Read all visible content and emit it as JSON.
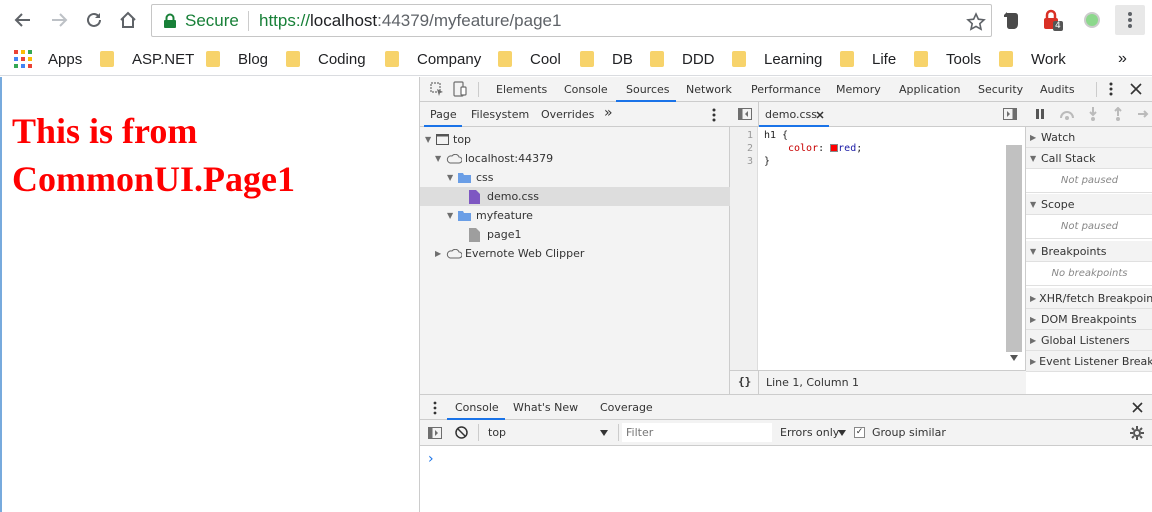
{
  "browser": {
    "secure_label": "Secure",
    "url_scheme": "https://",
    "url_host": "localhost",
    "url_rest": ":44379/myfeature/page1",
    "extension_badge": "4",
    "apps_label": "Apps"
  },
  "bookmarks": [
    "ASP.NET",
    "Blog",
    "Coding",
    "Company",
    "Cool",
    "DB",
    "DDD",
    "Learning",
    "Life",
    "Tools",
    "Work"
  ],
  "bookmarks_overflow": "»",
  "page": {
    "heading": "This is from CommonUI.Page1"
  },
  "devtools": {
    "tabs": [
      "Elements",
      "Console",
      "Sources",
      "Network",
      "Performance",
      "Memory",
      "Application",
      "Security",
      "Audits"
    ],
    "active_tab": "Sources",
    "navigator_tabs": [
      "Page",
      "Filesystem",
      "Overrides"
    ],
    "navigator_overflow": "»",
    "tree": {
      "top": "top",
      "host": "localhost:44379",
      "css_folder": "css",
      "css_file": "demo.css",
      "feature_folder": "myfeature",
      "feature_file": "page1",
      "extension": "Evernote Web Clipper"
    },
    "editor": {
      "tab_label": "demo.css",
      "lines": [
        {
          "num": "1",
          "text": "h1 {"
        },
        {
          "num": "2",
          "prop": "color",
          "value": "red"
        },
        {
          "num": "3",
          "text": "}"
        }
      ],
      "status": "Line 1, Column 1",
      "format_icon": "{}"
    },
    "debugger": {
      "watch": "Watch",
      "call_stack": "Call Stack",
      "call_stack_empty": "Not paused",
      "scope": "Scope",
      "scope_empty": "Not paused",
      "breakpoints": "Breakpoints",
      "breakpoints_empty": "No breakpoints",
      "xhr": "XHR/fetch Breakpoints",
      "dom": "DOM Breakpoints",
      "global": "Global Listeners",
      "event": "Event Listener Breakpoints"
    },
    "drawer": {
      "tabs": [
        "Console",
        "What's New",
        "Coverage"
      ],
      "active_tab": "Console",
      "context": "top",
      "filter_placeholder": "Filter",
      "level": "Errors only",
      "group_similar": "Group similar",
      "prompt": "›"
    }
  },
  "colors": {
    "heading": "#ff0000",
    "secure": "#188038",
    "accent": "#1a73e8",
    "swatch": "#ff0000"
  }
}
